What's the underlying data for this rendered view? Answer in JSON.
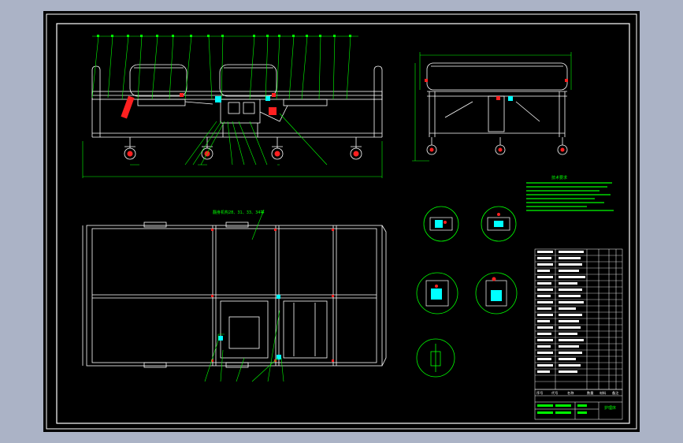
{
  "colors": {
    "background": "#abb3c6",
    "paper": "#000000",
    "outline": "#ffffff",
    "dimension": "#00ff00",
    "accent_red": "#ff2020",
    "accent_cyan": "#00ffff"
  },
  "drawing": {
    "plan_view_note": "翻身机构28、31、33、34等",
    "technical_requirements_title": "技术要求"
  },
  "title_block": {
    "headers": [
      "序号",
      "代号",
      "名称",
      "数量",
      "材料",
      "备注"
    ],
    "drawing_name": "护理床"
  }
}
